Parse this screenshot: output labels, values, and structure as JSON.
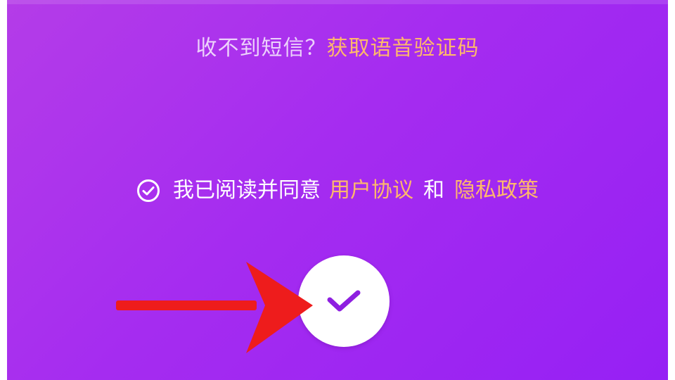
{
  "sms": {
    "question": "收不到短信？",
    "voice_code_link": "获取语音验证码"
  },
  "agreement": {
    "checked": true,
    "prefix": "我已阅读并同意",
    "user_agreement": "用户协议",
    "conjunction": "和",
    "privacy_policy": "隐私政策"
  },
  "confirm": {
    "icon": "checkmark-icon"
  },
  "annotation": {
    "icon": "red-arrow-icon",
    "color": "#ee1c1c"
  },
  "colors": {
    "background_start": "#b43ce8",
    "background_end": "#9620f4",
    "link": "#ffb86b",
    "checkmark": "#8e1fe0"
  }
}
